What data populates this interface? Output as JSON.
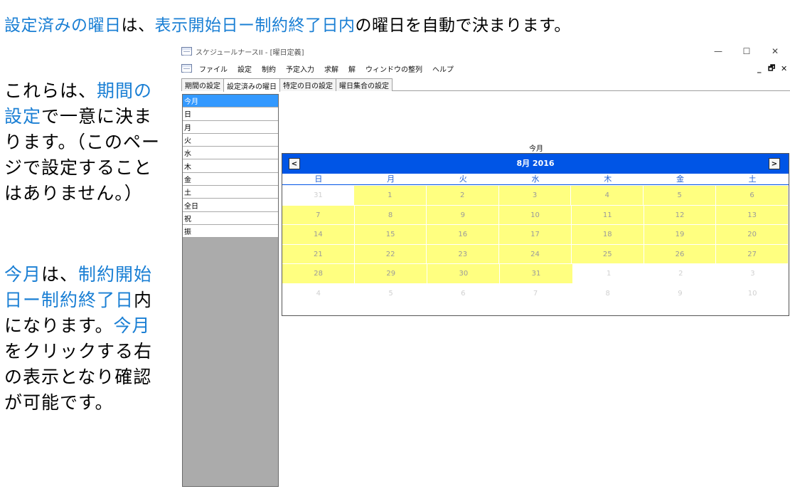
{
  "annotation": {
    "headline": [
      {
        "text": "設定済みの曜日",
        "blue": true
      },
      {
        "text": "は、",
        "blue": false
      },
      {
        "text": "表示開始日ー制約終了日内",
        "blue": true
      },
      {
        "text": "の曜日を自動で決まります。",
        "blue": false
      }
    ],
    "note1": [
      {
        "text": "これらは、",
        "blue": false
      },
      {
        "text": "期間の設定",
        "blue": true
      },
      {
        "text": "で一意に決まります。（このページで設定することはありません。）",
        "blue": false
      }
    ],
    "note2": [
      {
        "text": "今月",
        "blue": true
      },
      {
        "text": "は、",
        "blue": false
      },
      {
        "text": "制約開始日ー制約終了日",
        "blue": true
      },
      {
        "text": "内になります。",
        "blue": false
      },
      {
        "text": "今月",
        "blue": true
      },
      {
        "text": "をクリックする右の表示となり確認が可能です。",
        "blue": false
      }
    ]
  },
  "window": {
    "title": "スケジュールナースII - [曜日定義]",
    "controls": {
      "minimize": "—",
      "maximize": "☐",
      "close": "✕"
    },
    "mdi_controls": {
      "minimize": "_",
      "restore": "🗗",
      "close": "✕"
    },
    "menu": [
      "ファイル",
      "設定",
      "制約",
      "予定入力",
      "求解",
      "解",
      "ウィンドウの整列",
      "ヘルプ"
    ],
    "tabs": [
      {
        "label": "期間の設定",
        "active": false
      },
      {
        "label": "設定済みの曜日",
        "active": true
      },
      {
        "label": "特定の日の設定",
        "active": false
      },
      {
        "label": "曜日集合の設定",
        "active": false
      }
    ]
  },
  "list": {
    "items": [
      "今月",
      "日",
      "月",
      "火",
      "水",
      "木",
      "金",
      "土",
      "全日",
      "祝",
      "振"
    ],
    "selected_index": 0
  },
  "calendar": {
    "caption": "今月",
    "month_label": "8月 2016",
    "prev_label": "<",
    "next_label": ">",
    "weekdays": [
      "日",
      "月",
      "火",
      "水",
      "木",
      "金",
      "土"
    ],
    "weeks": [
      [
        {
          "d": "31",
          "s": "dim"
        },
        {
          "d": "1",
          "s": "in"
        },
        {
          "d": "2",
          "s": "in"
        },
        {
          "d": "3",
          "s": "in"
        },
        {
          "d": "4",
          "s": "in"
        },
        {
          "d": "5",
          "s": "in"
        },
        {
          "d": "6",
          "s": "in"
        }
      ],
      [
        {
          "d": "7",
          "s": "in"
        },
        {
          "d": "8",
          "s": "in"
        },
        {
          "d": "9",
          "s": "in"
        },
        {
          "d": "10",
          "s": "in"
        },
        {
          "d": "11",
          "s": "in"
        },
        {
          "d": "12",
          "s": "in"
        },
        {
          "d": "13",
          "s": "in"
        }
      ],
      [
        {
          "d": "14",
          "s": "in"
        },
        {
          "d": "15",
          "s": "in"
        },
        {
          "d": "16",
          "s": "in"
        },
        {
          "d": "17",
          "s": "in"
        },
        {
          "d": "18",
          "s": "in"
        },
        {
          "d": "19",
          "s": "in"
        },
        {
          "d": "20",
          "s": "in"
        }
      ],
      [
        {
          "d": "21",
          "s": "in"
        },
        {
          "d": "22",
          "s": "in"
        },
        {
          "d": "23",
          "s": "in"
        },
        {
          "d": "24",
          "s": "in"
        },
        {
          "d": "25",
          "s": "in"
        },
        {
          "d": "26",
          "s": "in"
        },
        {
          "d": "27",
          "s": "in"
        }
      ],
      [
        {
          "d": "28",
          "s": "in"
        },
        {
          "d": "29",
          "s": "in"
        },
        {
          "d": "30",
          "s": "in"
        },
        {
          "d": "31",
          "s": "in"
        },
        {
          "d": "1",
          "s": "dim"
        },
        {
          "d": "2",
          "s": "dim"
        },
        {
          "d": "3",
          "s": "dim"
        }
      ],
      [
        {
          "d": "4",
          "s": "dim"
        },
        {
          "d": "5",
          "s": "dim"
        },
        {
          "d": "6",
          "s": "dim"
        },
        {
          "d": "7",
          "s": "dim"
        },
        {
          "d": "8",
          "s": "dim"
        },
        {
          "d": "9",
          "s": "dim"
        },
        {
          "d": "10",
          "s": "dim"
        }
      ]
    ]
  },
  "colors": {
    "accent_text": "#1a7fd4",
    "calendar_header": "#0055e6",
    "in_range": "#ffff80",
    "selection": "#3399ff",
    "list_background": "#ababab"
  }
}
